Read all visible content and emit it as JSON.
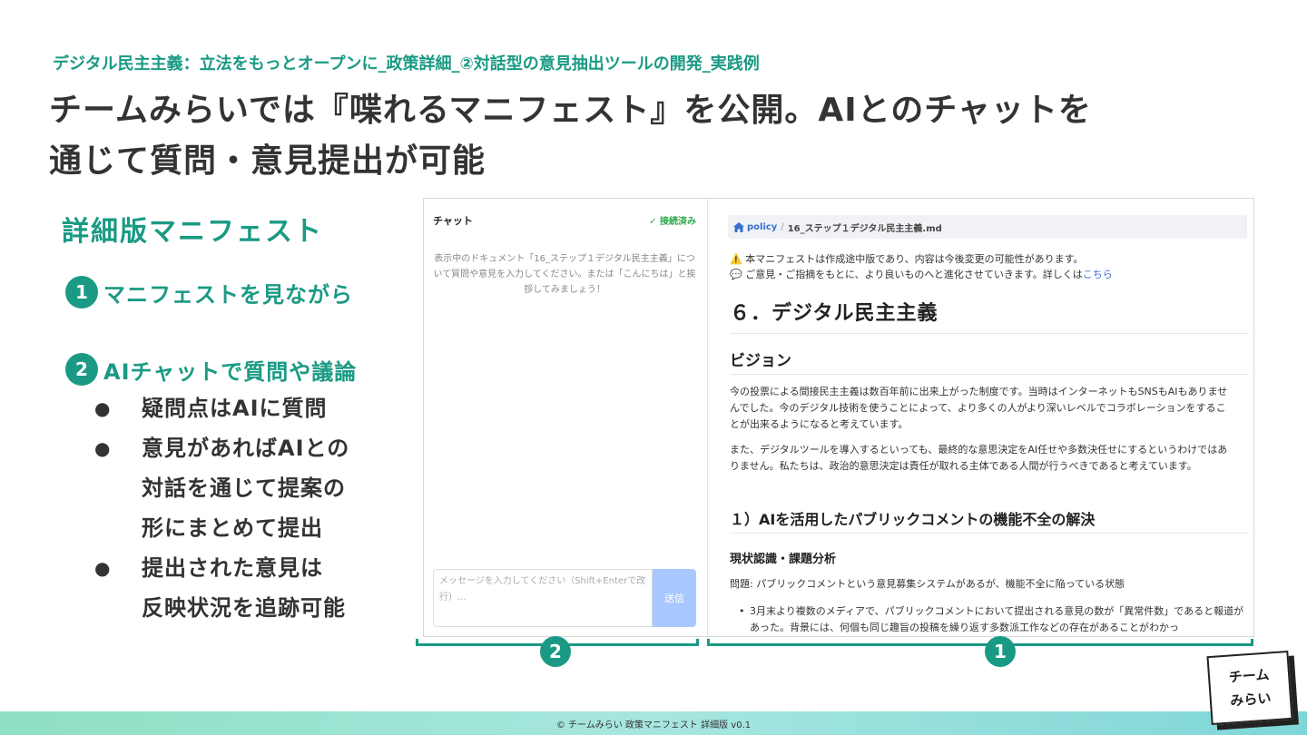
{
  "breadcrumb": "デジタル民主主義：立法をもっとオープンに_政策詳細_②対話型の意見抽出ツールの開発_実践例",
  "title": {
    "line1": "チームみらいでは『喋れるマニフェスト』を公開。AIとのチャットを",
    "line2": "通じて質問・意見提出が可能"
  },
  "left": {
    "heading": "詳細版マニフェスト",
    "steps": [
      {
        "num": "1",
        "label": "マニフェストを見ながら"
      },
      {
        "num": "2",
        "label": "AIチャットで質問や議論"
      }
    ],
    "bullet_symbol": "●",
    "bullets": [
      {
        "lines": [
          "疑問点はAIに質問"
        ]
      },
      {
        "lines": [
          "意見があればAIとの",
          "対話を通じて提案の",
          "形にまとめて提出"
        ]
      },
      {
        "lines": [
          "提出された意見は",
          "反映状況を追跡可能"
        ]
      }
    ]
  },
  "chat": {
    "title": "チャット",
    "status": "✓ 接続済み",
    "intro": "表示中のドキュメント「16_ステップ１デジタル民主主義」について質問や意見を入力してください。または「こんにちは」と挨拶してみましょう！",
    "input_placeholder": "メッセージを入力してください（Shift+Enterで改行）...",
    "send_label": "送信"
  },
  "doc": {
    "crumb_home": "policy",
    "crumb_sep": "/",
    "crumb_file": "16_ステップ１デジタル民主主義.md",
    "notice1_icon": "⚠️",
    "notice1": "本マニフェストは作成途中版であり、内容は今後変更の可能性があります。",
    "notice2_icon": "💬",
    "notice2": "ご意見・ご指摘をもとに、より良いものへと進化させていきます。詳しくは",
    "notice2_link": "こちら",
    "h1": "６．デジタル民主主義",
    "h2_vision": "ビジョン",
    "p1": "今の投票による間接民主主義は数百年前に出来上がった制度です。当時はインターネットもSNSもAIもありませんでした。今のデジタル技術を使うことによって、より多くの人がより深いレベルでコラボレーションをすることが出来るようになると考えています。",
    "p2": "また、デジタルツールを導入するといっても、最終的な意思決定をAI任せや多数決任せにするというわけではありません。私たちは、政治的意思決定は責任が取れる主体である人間が行うべきであると考えています。",
    "h2_sub": "１）AIを活用したパブリックコメントの機能不全の解決",
    "h3": "現状認識・課題分析",
    "problem": "問題: パブリックコメントという意見募集システムがあるが、機能不全に陥っている状態",
    "list1": "3月末より複数のメディアで、パブリックコメントにおいて提出される意見の数が「異常件数」であると報道があった。背景には、何個も同じ趣旨の投稿を繰り返す多数派工作などの存在があることがわかっ"
  },
  "callouts": {
    "chat": "2",
    "doc": "1"
  },
  "footer": "© チームみらい 政策マニフェスト 詳細版 v0.1",
  "logo": {
    "line1": "チーム",
    "line2": "みらい"
  },
  "colors": {
    "accent": "#1a9a84",
    "link": "#3a6fd0",
    "send_button": "#a9c8ff"
  }
}
